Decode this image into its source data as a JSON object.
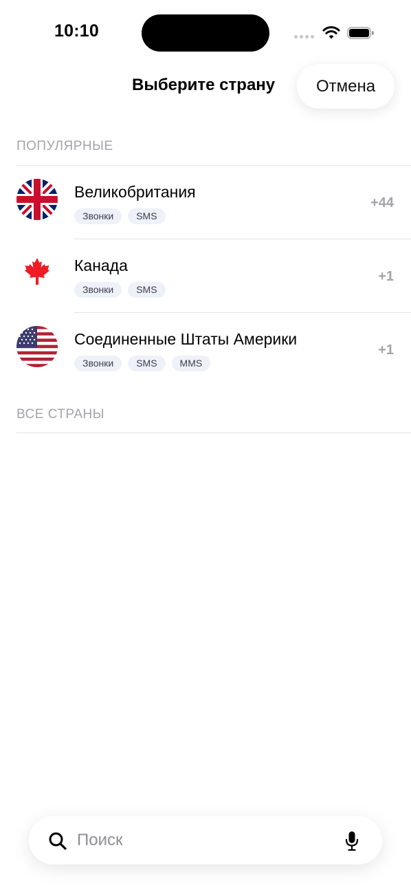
{
  "status_bar": {
    "time": "10:10"
  },
  "header": {
    "title": "Выберите страну",
    "cancel_label": "Отмена"
  },
  "sections": {
    "popular_title": "ПОПУЛЯРНЫЕ",
    "all_title": "ВСЕ СТРАНЫ"
  },
  "popular_countries": [
    {
      "name": "Великобритания",
      "dial_code": "+44",
      "flag_icon": "uk-flag-icon",
      "tags": [
        "Звонки",
        "SMS"
      ]
    },
    {
      "name": "Канада",
      "dial_code": "+1",
      "flag_icon": "canada-flag-icon",
      "tags": [
        "Звонки",
        "SMS"
      ]
    },
    {
      "name": "Соединенные Штаты Америки",
      "dial_code": "+1",
      "flag_icon": "usa-flag-icon",
      "tags": [
        "Звонки",
        "SMS",
        "MMS"
      ]
    }
  ],
  "search": {
    "placeholder": "Поиск",
    "value": ""
  },
  "colors": {
    "section_header": "#a4a4a8",
    "tag_background": "#eef1f8",
    "divider": "#e3e3e6"
  }
}
